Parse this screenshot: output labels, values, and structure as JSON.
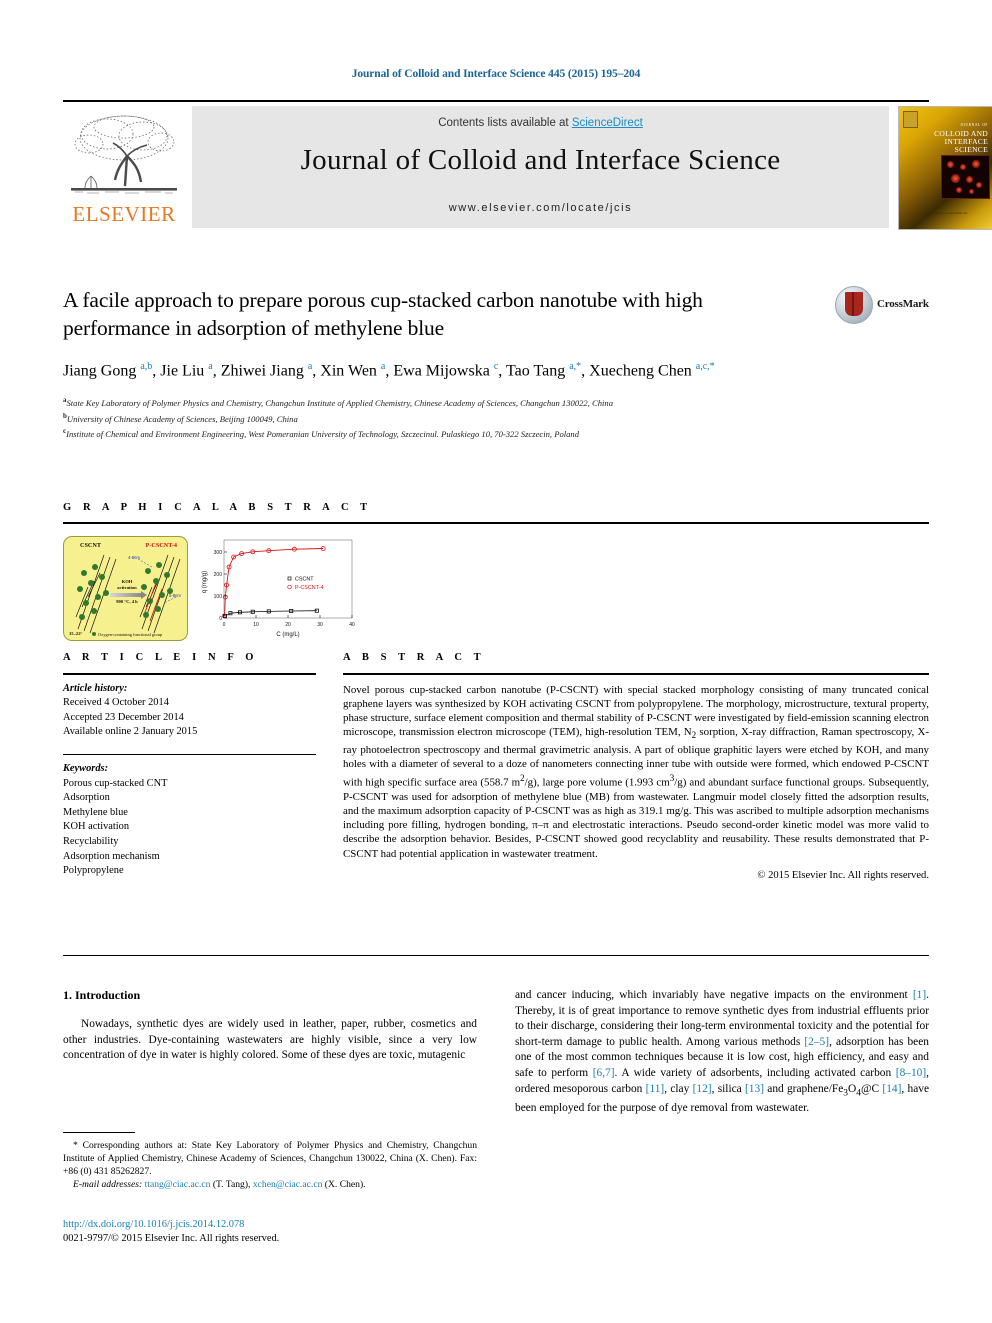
{
  "header": {
    "running_head": "Journal of Colloid and Interface Science 445 (2015) 195–204",
    "contents_prefix": "Contents lists available at ",
    "sciencedirect": "ScienceDirect",
    "journal_title": "Journal of Colloid and Interface Science",
    "journal_url": "www.elsevier.com/locate/jcis",
    "elsevier_wordmark": "ELSEVIER",
    "cover_title": "COLLOID AND INTERFACE SCIENCE",
    "cover_journal_kicker": "JOURNAL OF",
    "cover_footer": "Available online at www.sciencedirect.com",
    "accent_blue": "#1a6496",
    "link_blue": "#1a8cc8",
    "elsevier_orange": "#E87722"
  },
  "article": {
    "title": "A facile approach to prepare porous cup-stacked carbon nanotube with high performance in adsorption of methylene blue",
    "crossmark_label": "CrossMark",
    "authors_html": "Jiang Gong <sup class=\"aff-mark\">a,b</sup>, Jie Liu <sup class=\"aff-mark\">a</sup>, Zhiwei Jiang <sup class=\"aff-mark\">a</sup>, Xin Wen <sup class=\"aff-mark\">a</sup>, Ewa Mijowska <sup class=\"aff-mark\">c</sup>, Tao Tang <sup class=\"aff-mark\">a,*</sup>, Xuecheng Chen <sup class=\"aff-mark\">a,c,*</sup>",
    "affiliations": [
      {
        "mark": "a",
        "text": "State Key Laboratory of Polymer Physics and Chemistry, Changchun Institute of Applied Chemistry, Chinese Academy of Sciences, Changchun 130022, China"
      },
      {
        "mark": "b",
        "text": "University of Chinese Academy of Sciences, Beijing 100049, China"
      },
      {
        "mark": "c",
        "text": "Institute of Chemical and Environment Engineering, West Pomeranian University of Technology, Szczecinul. Pulaskiego 10, 70-322 Szczecin, Poland"
      }
    ]
  },
  "graphical_abstract": {
    "heading": "G R A P H I C A L   A B S T R A C T",
    "scheme": {
      "left_label": "CSCNT",
      "right_label": "P-CSCNT-4",
      "process_line1": "KOH",
      "process_line2": "activation",
      "process_line3": "900 °C, 4 h",
      "legend": "Oxygen-containing functional group",
      "angle_label": "15–22°",
      "micro_label": "4-8nm",
      "nano_label": "5-8nm"
    }
  },
  "chart_data": {
    "type": "scatter",
    "title": "",
    "xlabel": "C (mg/L)",
    "ylabel": "q (mg/g)",
    "xlim": [
      0,
      40
    ],
    "ylim": [
      0,
      350
    ],
    "xticks": [
      0,
      10,
      20,
      30,
      40
    ],
    "xtick_labels": [
      "0",
      "10",
      "20",
      "30",
      "40"
    ],
    "yticks": [
      0,
      100,
      200,
      300
    ],
    "ytick_labels": [
      "0",
      "100",
      "200",
      "300"
    ],
    "grid": false,
    "legend_position": "center-right",
    "series": [
      {
        "name": "CSCNT",
        "marker": "square",
        "color": "#111111",
        "x": [
          0.3,
          2.0,
          5.0,
          9.0,
          14.0,
          21.0,
          29.0
        ],
        "y": [
          8,
          22,
          26,
          28,
          30,
          32,
          33
        ]
      },
      {
        "name": "P-CSCNT-4",
        "marker": "circle",
        "color": "#dd1111",
        "x": [
          0.2,
          0.4,
          0.8,
          1.6,
          3.0,
          5.5,
          9.0,
          14.0,
          22.0,
          31.0
        ],
        "y": [
          10,
          95,
          150,
          230,
          275,
          292,
          300,
          305,
          312,
          315
        ]
      }
    ]
  },
  "article_info": {
    "heading": "A R T I C L E   I N F O",
    "history_label": "Article history:",
    "history": [
      "Received 4 October 2014",
      "Accepted 23 December 2014",
      "Available online 2 January 2015"
    ],
    "keywords_label": "Keywords:",
    "keywords": [
      "Porous cup-stacked CNT",
      "Adsorption",
      "Methylene blue",
      "KOH activation",
      "Recyclability",
      "Adsorption mechanism",
      "Polypropylene"
    ]
  },
  "abstract": {
    "heading": "A B S T R A C T",
    "text": "Novel porous cup-stacked carbon nanotube (P-CSCNT) with special stacked morphology consisting of many truncated conical graphene layers was synthesized by KOH activating CSCNT from polypropylene. The morphology, microstructure, textural property, phase structure, surface element composition and thermal stability of P-CSCNT were investigated by field-emission scanning electron microscope, transmission electron microscope (TEM), high-resolution TEM, N2 sorption, X-ray diffraction, Raman spectroscopy, X-ray photoelectron spectroscopy and thermal gravimetric analysis. A part of oblique graphitic layers were etched by KOH, and many holes with a diameter of several to a doze of nanometers connecting inner tube with outside were formed, which endowed P-CSCNT with high specific surface area (558.7 m2/g), large pore volume (1.993 cm3/g) and abundant surface functional groups. Subsequently, P-CSCNT was used for adsorption of methylene blue (MB) from wastewater. Langmuir model closely fitted the adsorption results, and the maximum adsorption capacity of P-CSCNT was as high as 319.1 mg/g. This was ascribed to multiple adsorption mechanisms including pore filling, hydrogen bonding, π–π and electrostatic interactions. Pseudo second-order kinetic model was more valid to describe the adsorption behavior. Besides, P-CSCNT showed good recyclablity and reusability. These results demonstrated that P-CSCNT had potential application in wastewater treatment.",
    "copyright": "© 2015 Elsevier Inc. All rights reserved."
  },
  "body": {
    "section_heading": "1. Introduction",
    "left_paragraph": "Nowadays, synthetic dyes are widely used in leather, paper, rubber, cosmetics and other industries. Dye-containing wastewaters are highly visible, since a very low concentration of dye in water is highly colored. Some of these dyes are toxic, mutagenic",
    "right_paragraph_html": "and cancer inducing, which invariably have negative impacts on the environment <span class=\"ref\">[1]</span>. Thereby, it is of great importance to remove synthetic dyes from industrial effluents prior to their discharge, considering their long-term environmental toxicity and the potential for short-term damage to public health. Among various methods <span class=\"ref\">[2–5]</span>, adsorption has been one of the most common techniques because it is low cost, high efficiency, and easy and safe to perform <span class=\"ref\">[6,7]</span>. A wide variety of adsorbents, including activated carbon <span class=\"ref\">[8–10]</span>, ordered mesoporous carbon <span class=\"ref\">[11]</span>, clay <span class=\"ref\">[12]</span>, silica <span class=\"ref\">[13]</span> and graphene/Fe<sub>3</sub>O<sub>4</sub>@C <span class=\"ref\">[14]</span>, have been employed for the purpose of dye removal from wastewater."
  },
  "footer": {
    "corresponding_html": "<span class=\"ind\">* Corresponding authors at: State Key Laboratory of Polymer Physics and Chemistry, Changchun Institute of Applied Chemistry, Chinese Academy of Sciences, Changchun 130022, China (X. Chen). Fax: +86 (0) 431 85262827.</span><span class=\"ind\"><span class=\"fn-em\">E-mail addresses:</span> <span class=\"mail\">ttang@ciac.ac.cn</span> (T. Tang), <span class=\"mail\">xchen@ciac.ac.cn</span> (X. Chen).</span>",
    "doi": "http://dx.doi.org/10.1016/j.jcis.2014.12.078",
    "issn_line": "0021-9797/© 2015 Elsevier Inc. All rights reserved."
  }
}
